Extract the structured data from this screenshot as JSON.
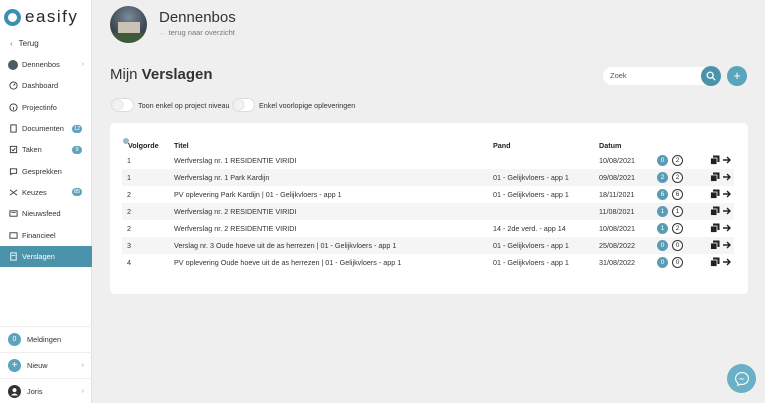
{
  "app": {
    "logo_text": "easify"
  },
  "sidebar": {
    "back_label": "Terug",
    "items": [
      {
        "label": "Dennenbos",
        "icon": "project-avatar-icon",
        "chevron": true
      },
      {
        "label": "Dashboard",
        "icon": "dashboard-icon"
      },
      {
        "label": "Projectinfo",
        "icon": "info-icon"
      },
      {
        "label": "Documenten",
        "icon": "documents-icon",
        "badge": "12"
      },
      {
        "label": "Taken",
        "icon": "tasks-icon",
        "badge": "9"
      },
      {
        "label": "Gesprekken",
        "icon": "chat-icon"
      },
      {
        "label": "Keuzes",
        "icon": "choices-icon",
        "badge": "85"
      },
      {
        "label": "Nieuwsfeed",
        "icon": "newsfeed-icon"
      },
      {
        "label": "Financieel",
        "icon": "finance-icon"
      },
      {
        "label": "Verslagen",
        "icon": "reports-icon",
        "active": true
      }
    ],
    "notifications": {
      "label": "Meldingen",
      "count": "0"
    },
    "new": {
      "label": "Nieuw"
    },
    "user": {
      "label": "Joris"
    }
  },
  "header": {
    "project_title": "Dennenbos",
    "back_link": "terug naar overzicht"
  },
  "page": {
    "title_light": "Mijn ",
    "title_bold": "Verslagen"
  },
  "search": {
    "value": "Zoek"
  },
  "toggles": {
    "project_level": "Toon enkel op project niveau",
    "provisional": "Enkel voorlopige opleveringen"
  },
  "table": {
    "headers": {
      "order": "Volgorde",
      "title": "Titel",
      "pand": "Pand",
      "date": "Datum"
    },
    "rows": [
      {
        "order": "1",
        "title": "Werfverslag nr. 1 RESIDENTIE VIRIDI",
        "pand": "",
        "date": "10/08/2021",
        "count_a": "0",
        "count_b": "2"
      },
      {
        "order": "1",
        "title": "Werfverslag nr. 1 Park Kardijn",
        "pand": "01 - Gelijkvloers - app 1",
        "date": "09/08/2021",
        "count_a": "2",
        "count_b": "2"
      },
      {
        "order": "2",
        "title": "PV oplevering Park Kardijn | 01 - Gelijkvloers - app 1",
        "pand": "01 - Gelijkvloers - app 1",
        "date": "18/11/2021",
        "count_a": "6",
        "count_b": "6"
      },
      {
        "order": "2",
        "title": "Werfverslag nr. 2 RESIDENTIE VIRIDI",
        "pand": "",
        "date": "11/08/2021",
        "count_a": "1",
        "count_b": "1"
      },
      {
        "order": "2",
        "title": "Werfverslag nr. 2 RESIDENTIE VIRIDI",
        "pand": "14 - 2de verd. - app 14",
        "date": "10/08/2021",
        "count_a": "1",
        "count_b": "2"
      },
      {
        "order": "3",
        "title": "Verslag nr. 3 Oude hoeve uit de as herrezen | 01 - Gelijkvloers - app 1",
        "pand": "01 - Gelijkvloers - app 1",
        "date": "25/08/2022",
        "count_a": "0",
        "count_b": "0"
      },
      {
        "order": "4",
        "title": "PV oplevering Oude hoeve uit de as herrezen | 01 - Gelijkvloers - app 1",
        "pand": "01 - Gelijkvloers - app 1",
        "date": "31/08/2022",
        "count_a": "0",
        "count_b": "0"
      }
    ]
  },
  "colors": {
    "accent": "#4a93ab",
    "badge": "#5a9cb5"
  }
}
